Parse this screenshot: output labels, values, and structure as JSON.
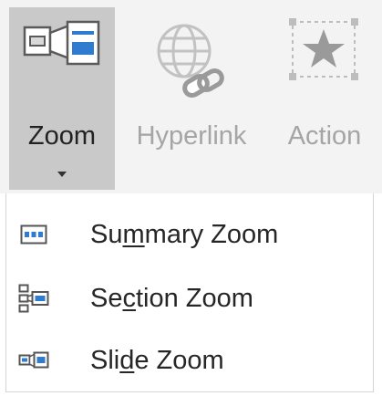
{
  "ribbon": {
    "zoom": {
      "label": "Zoom",
      "icon": "zoom-icon",
      "state": "pressed"
    },
    "hyperlink": {
      "label": "Hyperlink",
      "icon": "hyperlink-icon",
      "state": "disabled"
    },
    "action": {
      "label": "Action",
      "icon": "action-star-icon",
      "state": "disabled"
    }
  },
  "menu": {
    "items": [
      {
        "pre": "Su",
        "key": "m",
        "post": "mary Zoom",
        "icon": "summary-zoom-icon"
      },
      {
        "pre": "Se",
        "key": "c",
        "post": "tion Zoom",
        "icon": "section-zoom-icon"
      },
      {
        "pre": "Sli",
        "key": "d",
        "post": "e Zoom",
        "icon": "slide-zoom-icon"
      }
    ]
  },
  "colors": {
    "accent_blue": "#2e7bcf",
    "pressed_bg": "#c9c9c9",
    "disabled_text": "#a5a5a5"
  }
}
